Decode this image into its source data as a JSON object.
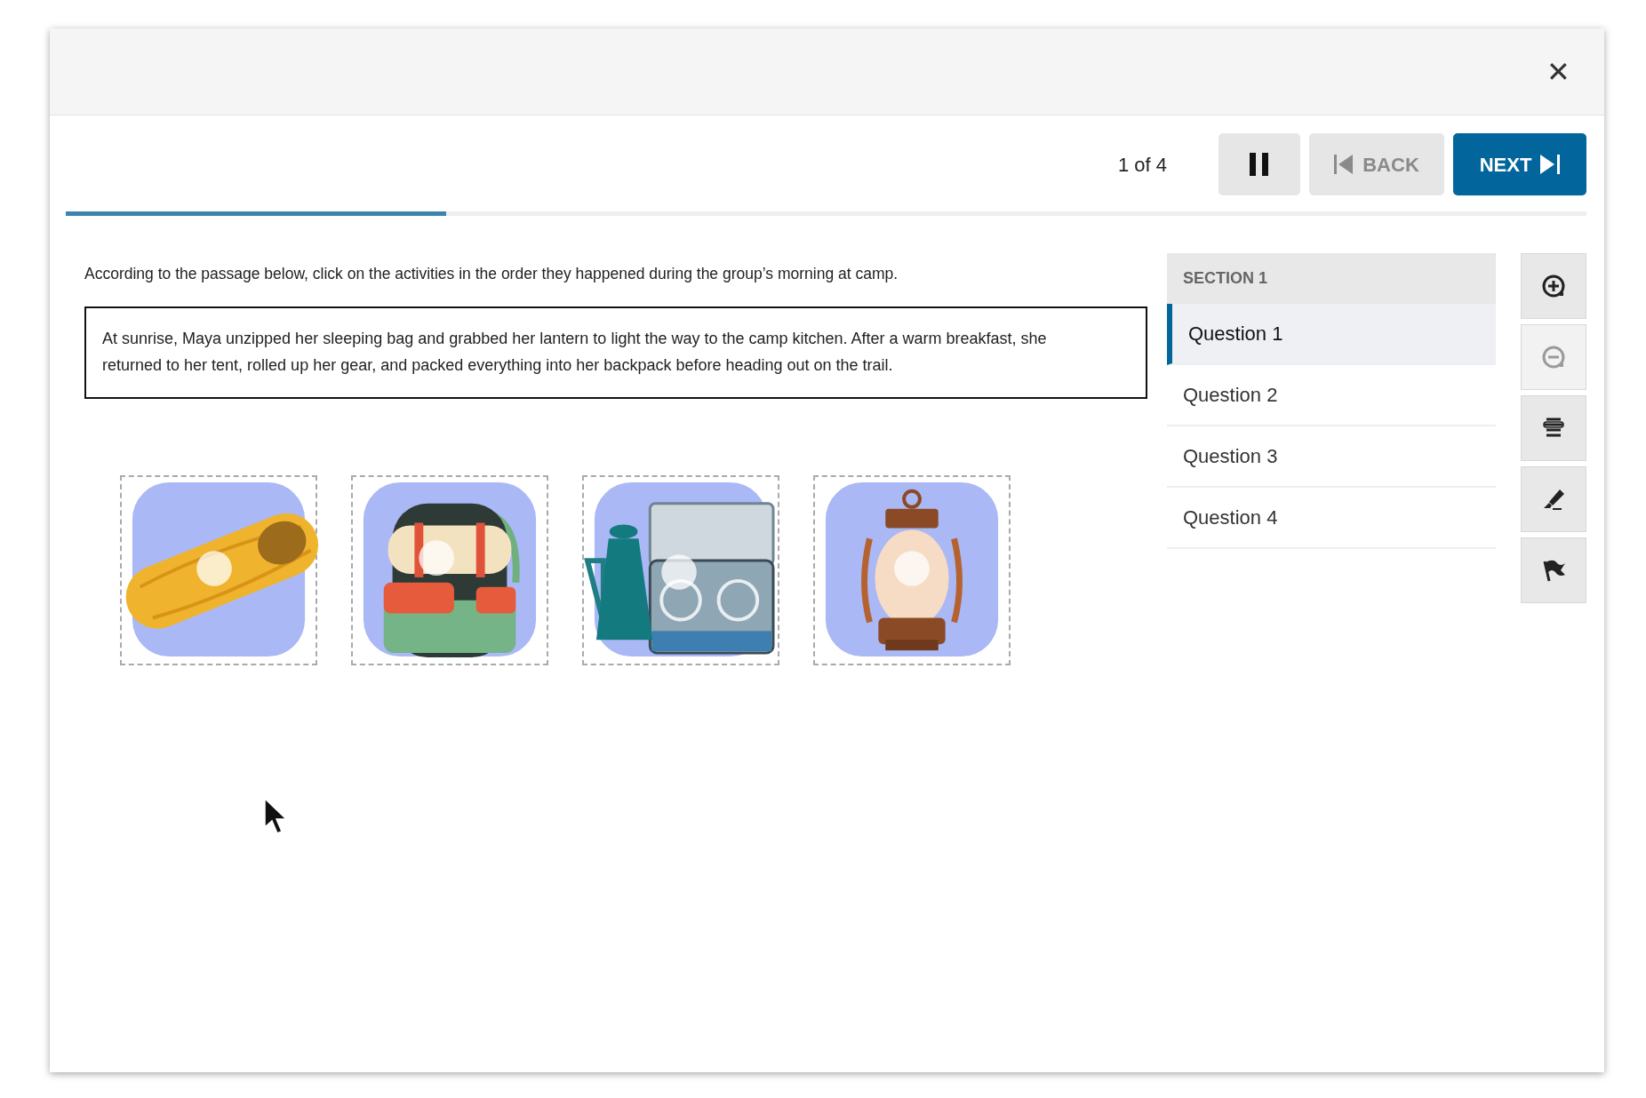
{
  "window": {
    "close": "✕"
  },
  "toolbar": {
    "counter": "1 of 4",
    "buttons": [
      {
        "kind": "pause",
        "disabled": false
      },
      {
        "kind": "back",
        "label": "BACK",
        "disabled": true
      },
      {
        "kind": "next",
        "label": "NEXT",
        "disabled": false
      }
    ]
  },
  "progress": {
    "level": 0.25
  },
  "prompt": "According to the passage below, click on the activities in the order they happened during the group’s morning at camp.",
  "passage": "At sunrise, Maya unzipped her sleeping bag and grabbed her lantern to light the way to the camp kitchen. After a warm breakfast, she returned to her tent, rolled up her gear, and packed everything into her backpack before heading out on the trail.",
  "options": [
    {
      "kind": "sleeping-bag"
    },
    {
      "kind": "backpack"
    },
    {
      "kind": "stove"
    },
    {
      "kind": "lantern"
    }
  ],
  "sidebar": {
    "section": "SECTION 1",
    "questions": [
      {
        "label": "Question 1",
        "selected": true
      },
      {
        "label": "Question 2",
        "selected": false
      },
      {
        "label": "Question 3",
        "selected": false
      },
      {
        "label": "Question 4",
        "selected": false
      }
    ]
  },
  "tools": [
    {
      "kind": "zoom-in",
      "disabled": false
    },
    {
      "kind": "zoom-out",
      "disabled": true
    },
    {
      "kind": "line-reader",
      "disabled": false
    },
    {
      "kind": "highlighter",
      "disabled": false
    },
    {
      "kind": "flag",
      "disabled": false
    }
  ]
}
